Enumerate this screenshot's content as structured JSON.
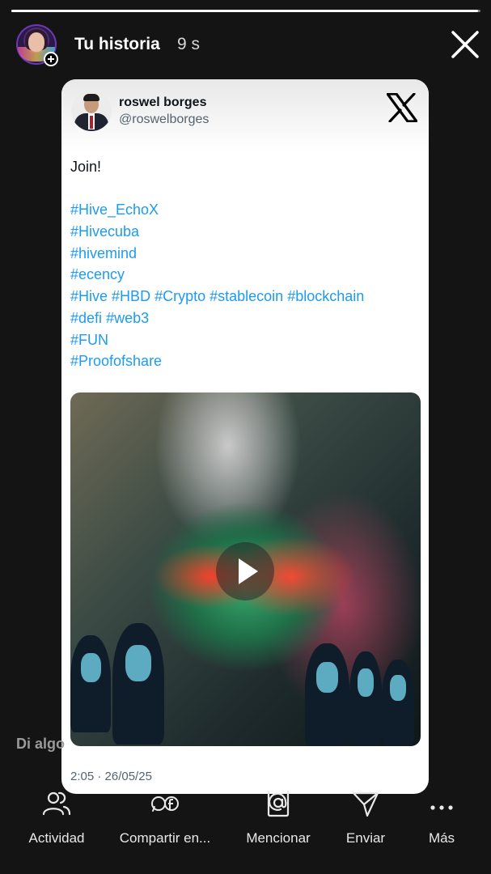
{
  "story": {
    "progress": 0.995,
    "title": "Tu historia",
    "time": "9 s"
  },
  "tweet": {
    "author_name": "roswel borges",
    "author_handle": "@roswelborges",
    "text_intro": "Join!",
    "hashtags": {
      "l1": "#Hive_EchoX",
      "l2": "#Hivecuba",
      "l3": "#hivemind",
      "l4": "#ecency",
      "l5a": "#Hive",
      "l5b": "#HBD",
      "l5c": "#Crypto",
      "l5d": "#stablecoin",
      "l5e": "#blockchain",
      "l6a": "#defi",
      "l6b": "#web3",
      "l7": "#FUN",
      "l8": "#Proofofshare"
    },
    "meta": "2:05 · 26/05/25",
    "media_icon": "play-icon"
  },
  "reply_placeholder": "Di algo",
  "bottom_bar": {
    "activity": "Actividad",
    "share": "Compartir en...",
    "mention": "Mencionar",
    "send": "Enviar",
    "more": "Más"
  },
  "colors": {
    "background": "#141414",
    "hashtag": "#1d9bf0",
    "card": "#ffffff"
  }
}
